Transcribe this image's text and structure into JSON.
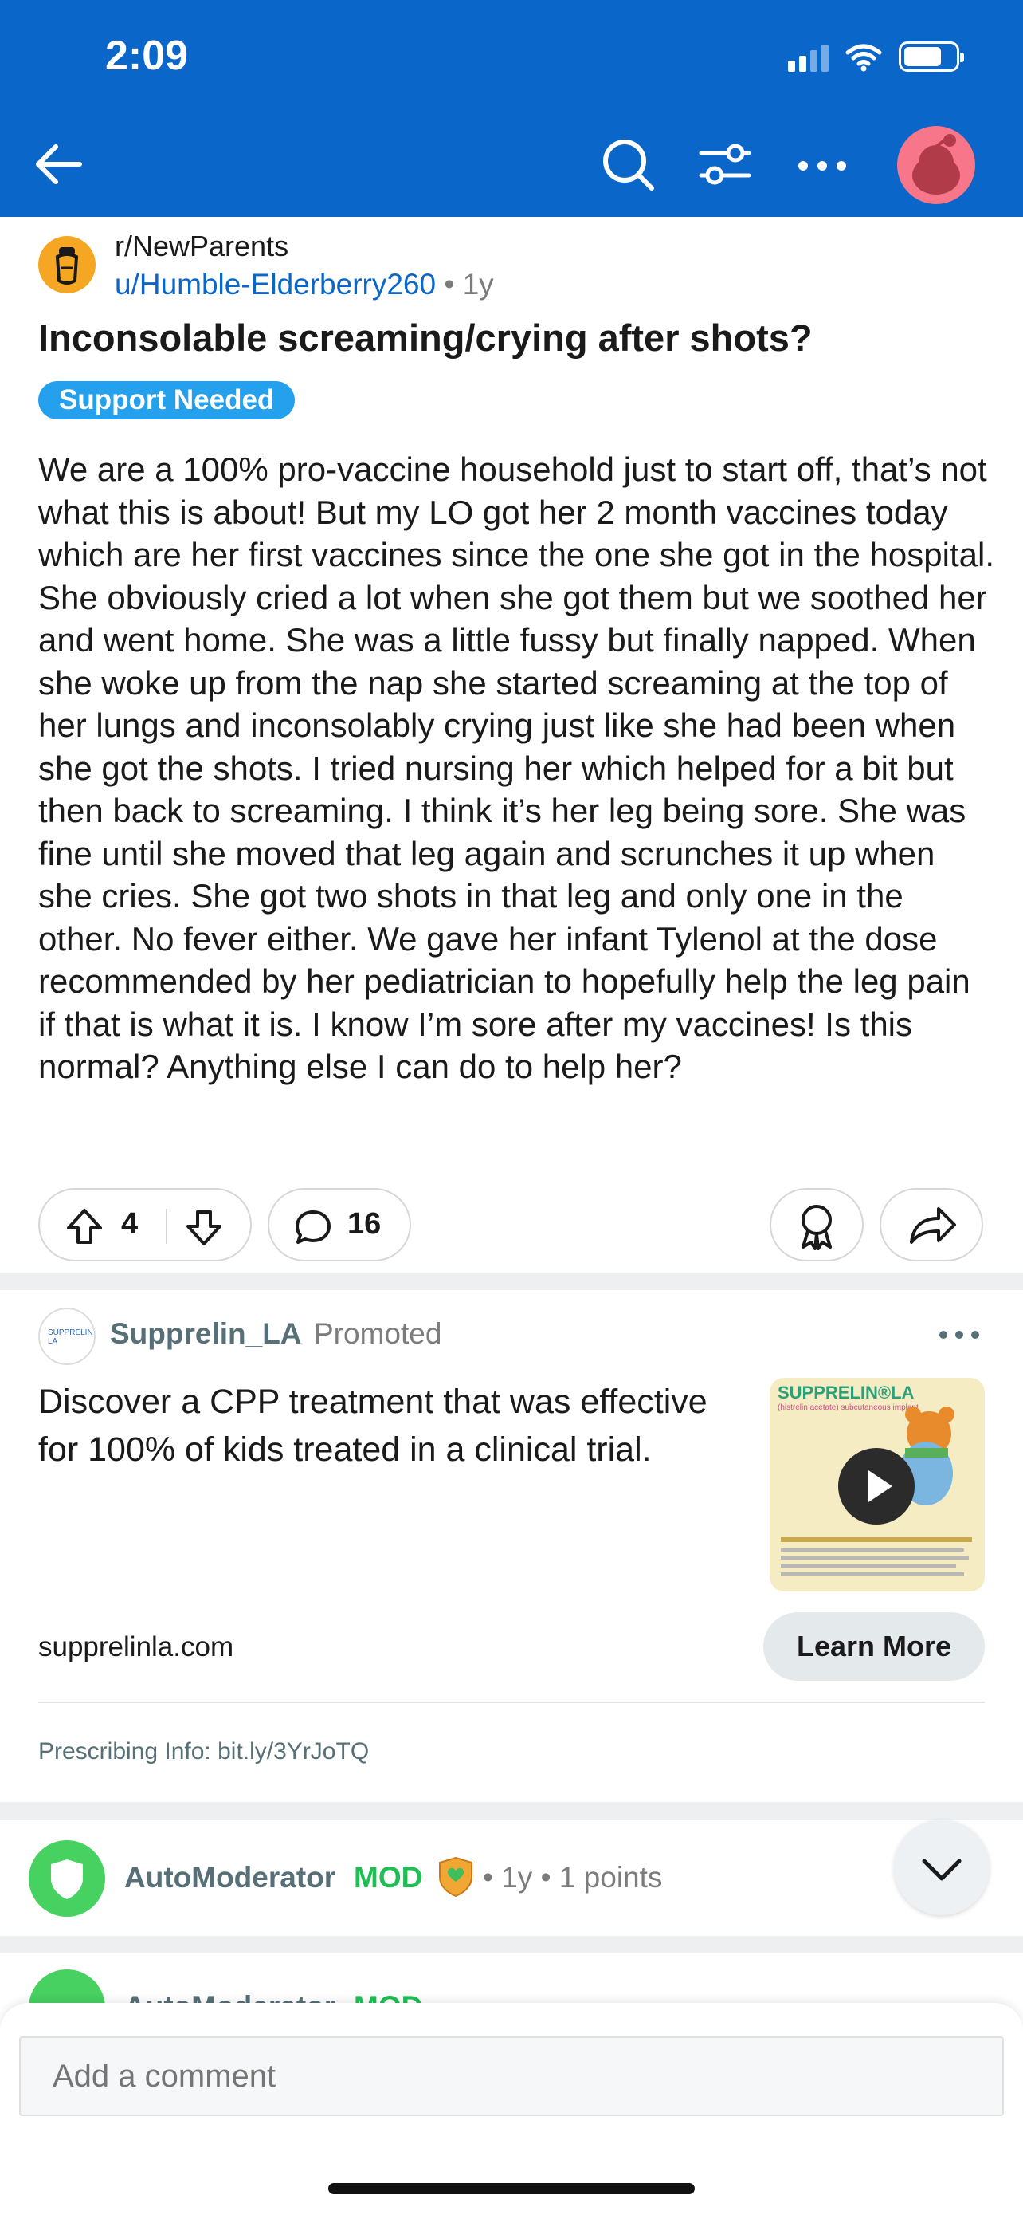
{
  "status_bar": {
    "time": "2:09"
  },
  "post": {
    "subreddit": "r/NewParents",
    "author": "u/Humble-Elderberry260",
    "age": "1y",
    "title": "Inconsolable screaming/crying after shots?",
    "flair": "Support Needed",
    "body": "We are a 100% pro-vaccine household just to start off, that’s not what this is about! But my LO got her 2 month vaccines today which are her first vaccines since the one she got in the hospital. She obviously cried a lot when she got them but we soothed her and went home. She was a little fussy but finally napped. When she woke up from the nap she started screaming at the top of her lungs and inconsolably crying just like she had been when she got the shots. I tried nursing her which helped for a bit but then back to screaming. I think it’s her leg being sore. She was fine until she moved that leg again and scrunches it up when she cries. She got two shots in that leg and only one in the other. No fever either. We gave her infant Tylenol at the dose recommended by her pediatrician to hopefully help the leg pain if that is what it is. I know I’m sore after my vaccines! Is this normal? Anything else I can do to help her?",
    "votes": "4",
    "comments": "16"
  },
  "ad": {
    "name": "Supprelin_LA",
    "promoted": "Promoted",
    "text": "Discover a CPP treatment that was effective for 100% of kids treated in a clinical trial.",
    "image_brand": "SUPPRELIN®LA",
    "image_sub": "(histrelin acetate) subcutaneous implant",
    "avatar_text": "SUPPRELIN LA",
    "domain": "supprelinla.com",
    "cta": "Learn More",
    "prescribing": "Prescribing Info: bit.ly/3YrJoTQ"
  },
  "comments": [
    {
      "author": "AutoModerator",
      "badge": "MOD",
      "age": "1y",
      "points": "1 points"
    },
    {
      "author": "AutoModerator",
      "badge": "MOD"
    }
  ],
  "composer": {
    "placeholder": "Add a comment"
  },
  "colors": {
    "header": "#0a66c8",
    "flair": "#24a0ed",
    "mod": "#46d160"
  }
}
